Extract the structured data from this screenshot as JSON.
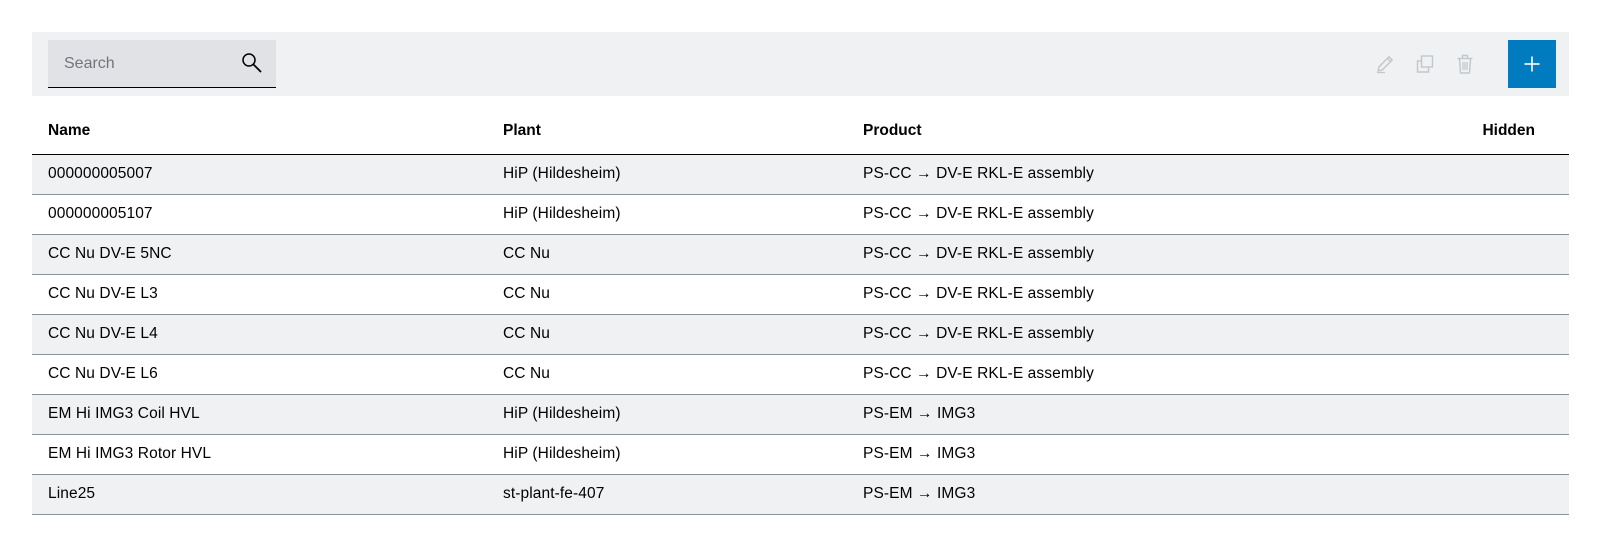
{
  "toolbar": {
    "search": {
      "placeholder": "Search",
      "value": ""
    },
    "actions": {
      "edit_icon": "pencil-icon",
      "copy_icon": "copy-icon",
      "delete_icon": "trash-icon",
      "add_icon": "plus-icon"
    },
    "colors": {
      "toolbar_bg": "#eff1f2",
      "accent": "#007bc0",
      "disabled_icon": "#c1c7cc"
    }
  },
  "table": {
    "headers": {
      "name": "Name",
      "plant": "Plant",
      "product": "Product",
      "hidden": "Hidden"
    },
    "rows": [
      {
        "name": "000000005007",
        "plant": "HiP (Hildesheim)",
        "product": "PS-CC → DV-E RKL-E assembly",
        "hidden": ""
      },
      {
        "name": "000000005107",
        "plant": "HiP (Hildesheim)",
        "product": "PS-CC → DV-E RKL-E assembly",
        "hidden": ""
      },
      {
        "name": "CC Nu DV-E 5NC",
        "plant": "CC Nu",
        "product": "PS-CC → DV-E RKL-E assembly",
        "hidden": ""
      },
      {
        "name": "CC Nu DV-E L3",
        "plant": "CC Nu",
        "product": "PS-CC → DV-E RKL-E assembly",
        "hidden": ""
      },
      {
        "name": "CC Nu DV-E L4",
        "plant": "CC Nu",
        "product": "PS-CC → DV-E RKL-E assembly",
        "hidden": ""
      },
      {
        "name": "CC Nu DV-E L6",
        "plant": "CC Nu",
        "product": "PS-CC → DV-E RKL-E assembly",
        "hidden": ""
      },
      {
        "name": "EM Hi IMG3 Coil HVL",
        "plant": "HiP (Hildesheim)",
        "product": "PS-EM → IMG3",
        "hidden": ""
      },
      {
        "name": "EM Hi IMG3 Rotor HVL",
        "plant": "HiP (Hildesheim)",
        "product": "PS-EM → IMG3",
        "hidden": ""
      },
      {
        "name": "Line25",
        "plant": "st-plant-fe-407",
        "product": "PS-EM → IMG3",
        "hidden": ""
      }
    ]
  }
}
